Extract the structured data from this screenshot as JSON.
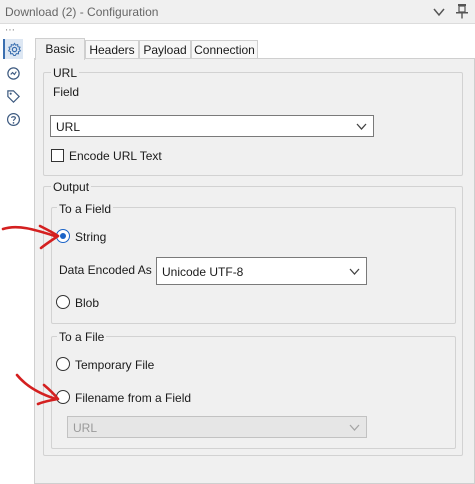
{
  "window": {
    "title": "Download (2) - Configuration"
  },
  "tabs": [
    {
      "label": "Basic",
      "active": true
    },
    {
      "label": "Headers",
      "active": false
    },
    {
      "label": "Payload",
      "active": false
    },
    {
      "label": "Connection",
      "active": false
    }
  ],
  "url_group": {
    "legend": "URL",
    "field_label": "Field",
    "field_value": "URL",
    "encode_label": "Encode URL Text",
    "encode_checked": false
  },
  "output_group": {
    "legend": "Output",
    "to_field": {
      "legend": "To a Field",
      "string_label": "String",
      "string_selected": true,
      "encoding_label": "Data Encoded As",
      "encoding_value": "Unicode UTF-8",
      "blob_label": "Blob",
      "blob_selected": false
    },
    "to_file": {
      "legend": "To a File",
      "temp_label": "Temporary File",
      "temp_selected": false,
      "filename_label": "Filename from a Field",
      "filename_selected": false,
      "field_value": "URL",
      "field_enabled": false
    }
  },
  "colors": {
    "accent": "#1a63c7",
    "panel": "#f0f0f0",
    "annotation": "#d42020"
  }
}
